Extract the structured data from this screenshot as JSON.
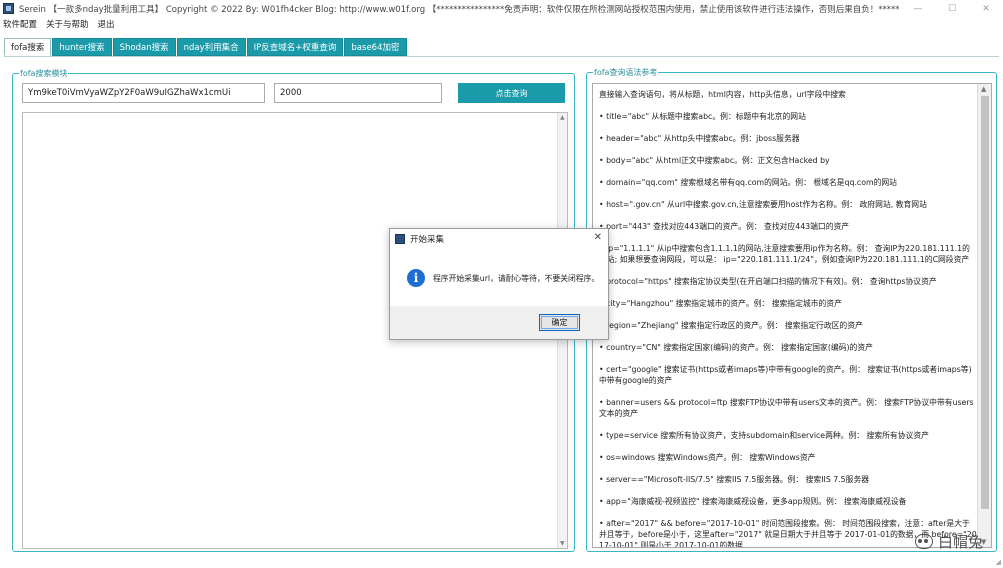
{
  "window": {
    "title": "Serein  【一款多nday批量利用工具】   Copyright © 2022   By: W01fh4cker   Blog: http://www.w01f.org     【****************免责声明：软件仅限在所检测网站授权范围内使用，禁止使用该软件进行违法操作，否则后果自负！****************】",
    "minimize": "—",
    "maximize": "☐",
    "close": "✕"
  },
  "menu": {
    "items": [
      "软件配置",
      "关于与帮助",
      "退出"
    ]
  },
  "tabs": [
    {
      "label": "fofa搜索",
      "active": true
    },
    {
      "label": "hunter搜索",
      "active": false
    },
    {
      "label": "Shodan搜索",
      "active": false
    },
    {
      "label": "nday利用集合",
      "active": false
    },
    {
      "label": "IP反查域名+权重查询",
      "active": false
    },
    {
      "label": "base64加密",
      "active": false
    }
  ],
  "fofa_panel": {
    "group_title": "fofa搜索模块",
    "query_value": "Ym9keT0iVmVyaWZpY2F0aW9uIGZhaWx1cmUi",
    "size_value": "2000",
    "search_button": "点击查询",
    "result_text": ""
  },
  "syntax_panel": {
    "group_title": "fofa查询语法参考",
    "lines": [
      "直接输入查询语句，将从标题，html内容，http头信息，url字段中搜索",
      "• title=\"abc\" 从标题中搜索abc。例：标题中有北京的网站",
      "• header=\"abc\" 从http头中搜索abc。例：jboss服务器",
      "• body=\"abc\" 从html正文中搜索abc。例：正文包含Hacked by",
      "• domain=\"qq.com\" 搜索根域名带有qq.com的网站。例：  根域名是qq.com的网站",
      "• host=\".gov.cn\" 从url中搜索.gov.cn,注意搜索要用host作为名称。例：  政府网站, 教育网站",
      "• port=\"443\" 查找对应443端口的资产。例：  查找对应443端口的资产",
      "• ip=\"1.1.1.1\" 从ip中搜索包含1.1.1.1的网站,注意搜索要用ip作为名称。例：  查询IP为220.181.111.1的网站; 如果想要查询网段，可以是：  ip=\"220.181.111.1/24\"，例如查询IP为220.181.111.1的C网段资产",
      "• protocol=\"https\" 搜索指定协议类型(在开启端口扫描的情况下有效)。例：  查询https协议资产",
      "• city=\"Hangzhou\" 搜索指定城市的资产。例：  搜索指定城市的资产",
      "• region=\"Zhejiang\" 搜索指定行政区的资产。例：  搜索指定行政区的资产",
      "• country=\"CN\" 搜索指定国家(编码)的资产。例：  搜索指定国家(编码)的资产",
      "• cert=\"google\" 搜索证书(https或者imaps等)中带有google的资产。例：  搜索证书(https或者imaps等)中带有google的资产",
      "• banner=users && protocol=ftp 搜索FTP协议中带有users文本的资产。例：  搜索FTP协议中带有users文本的资产",
      "• type=service 搜索所有协议资产，支持subdomain和service两种。例：  搜索所有协议资产",
      "• os=windows 搜索Windows资产。例：  搜索Windows资产",
      "• server==\"Microsoft-IIS/7.5\" 搜索IIS 7.5服务器。例：  搜索IIS 7.5服务器",
      "• app=\"海康威视-视频监控\" 搜索海康威视设备，更多app规则。例：  搜索海康威视设备",
      "• after=\"2017\" && before=\"2017-10-01\" 时间范围段搜索。例：  时间范围段搜索，注意：after是大于并且等于，before是小于，这里after=\"2017\" 就是日期大于并且等于 2017-01-01的数据，而 before=\"2017-10-01\" 则是小于 2017-10-01的数据"
    ]
  },
  "dialog": {
    "title": "开始采集",
    "message": "程序开始采集url，请耐心等待，不要关闭程序。",
    "ok_button": "确定",
    "close": "✕",
    "icon": "info-icon"
  },
  "watermark": {
    "text": "白帽兔",
    "icon": "wechat-icon"
  }
}
